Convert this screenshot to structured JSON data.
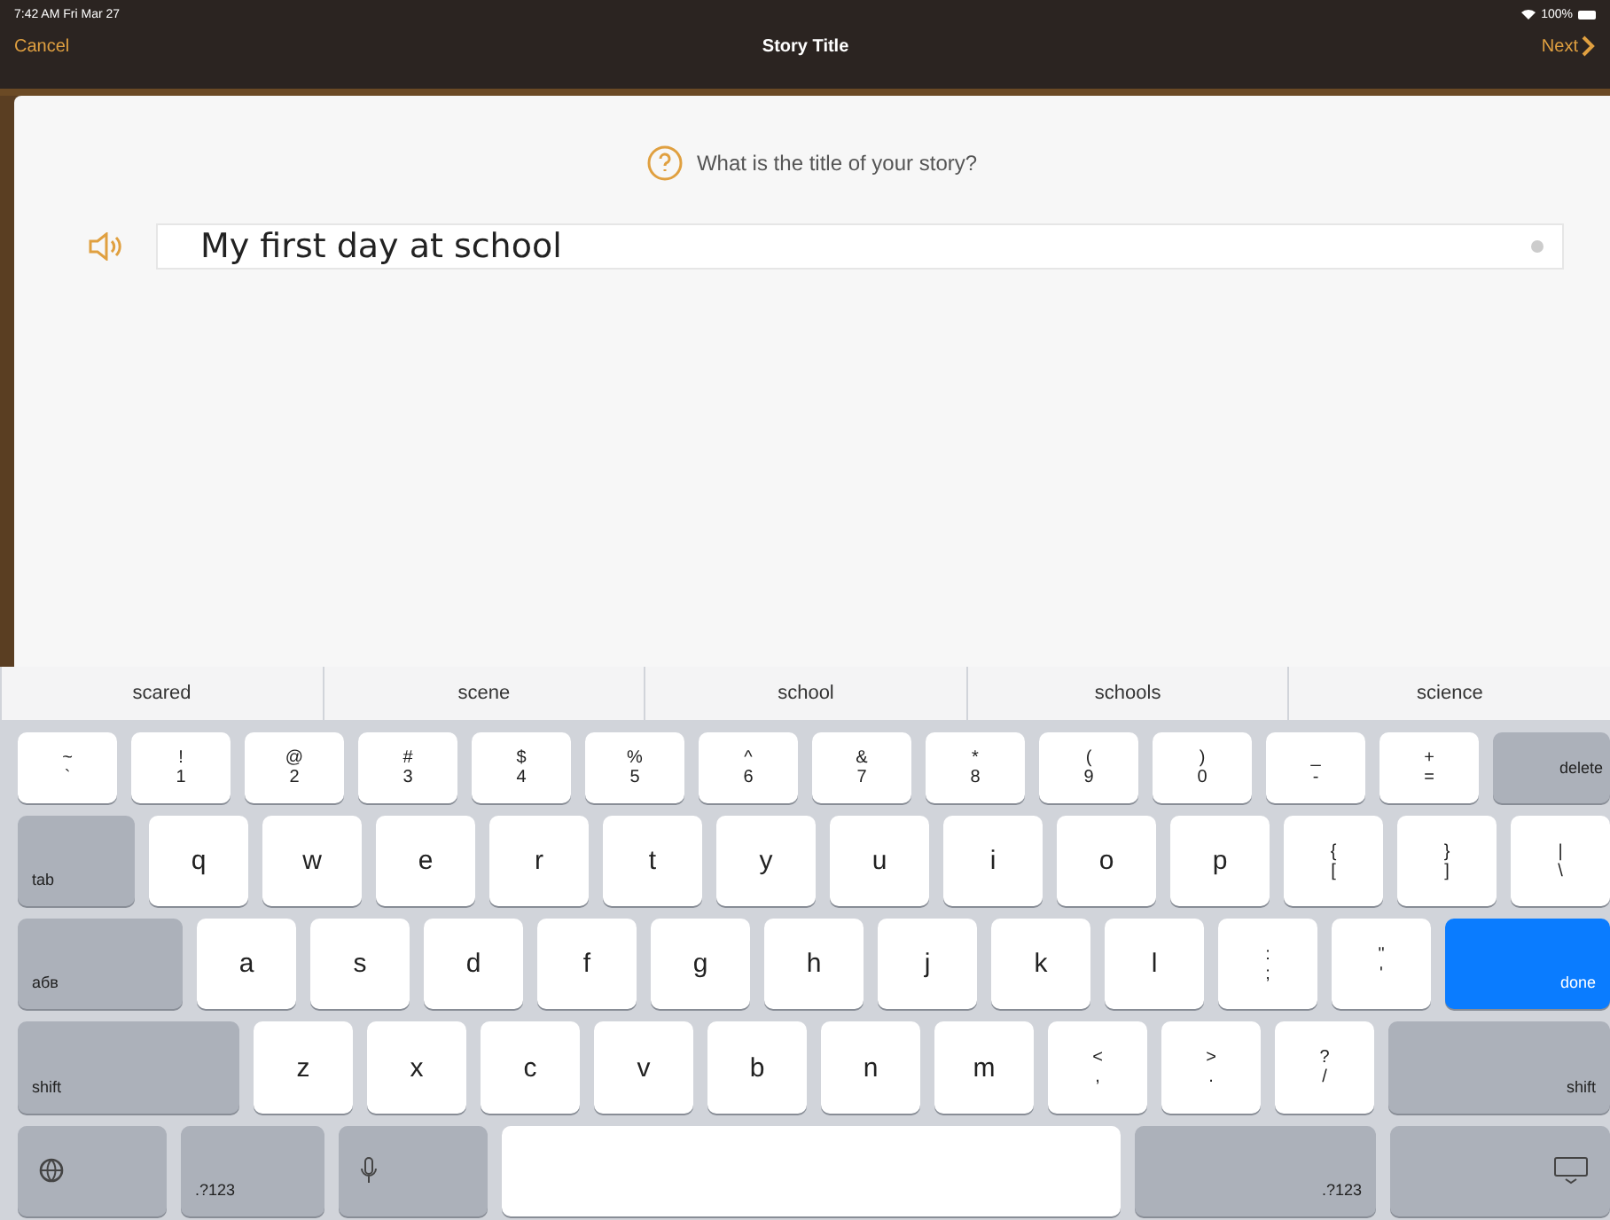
{
  "status_bar": {
    "time": "7:42 AM  Fri Mar 27",
    "battery": "100%"
  },
  "nav_bar": {
    "cancel": "Cancel",
    "title": "Story Title",
    "next": "Next"
  },
  "prompt": "What is the title of your story?",
  "title_field": {
    "value": "My first day at school"
  },
  "keyboard": {
    "suggestions": [
      "scared",
      "scene",
      "school",
      "schools",
      "science"
    ],
    "rows": [
      [
        {
          "kind": "char",
          "top": "~",
          "label": "`"
        },
        {
          "kind": "char",
          "top": "!",
          "label": "1"
        },
        {
          "kind": "char",
          "top": "@",
          "label": "2"
        },
        {
          "kind": "char",
          "top": "#",
          "label": "3"
        },
        {
          "kind": "char",
          "top": "$",
          "label": "4"
        },
        {
          "kind": "char",
          "top": "%",
          "label": "5"
        },
        {
          "kind": "char",
          "top": "^",
          "label": "6"
        },
        {
          "kind": "char",
          "top": "&",
          "label": "7"
        },
        {
          "kind": "char",
          "top": "*",
          "label": "8"
        },
        {
          "kind": "char",
          "top": "(",
          "label": "9"
        },
        {
          "kind": "char",
          "top": ")",
          "label": "0"
        },
        {
          "kind": "char",
          "top": "_",
          "label": "-"
        },
        {
          "kind": "char",
          "top": "+",
          "label": "="
        },
        {
          "kind": "function",
          "label": "delete"
        }
      ],
      [
        {
          "kind": "function",
          "label": "tab"
        },
        {
          "kind": "char",
          "label": "q"
        },
        {
          "kind": "char",
          "label": "w"
        },
        {
          "kind": "char",
          "label": "e"
        },
        {
          "kind": "char",
          "label": "r"
        },
        {
          "kind": "char",
          "label": "t"
        },
        {
          "kind": "char",
          "label": "y"
        },
        {
          "kind": "char",
          "label": "u"
        },
        {
          "kind": "char",
          "label": "i"
        },
        {
          "kind": "char",
          "label": "o"
        },
        {
          "kind": "char",
          "label": "p"
        },
        {
          "kind": "char",
          "top": "{",
          "label": "["
        },
        {
          "kind": "char",
          "top": "}",
          "label": "]"
        },
        {
          "kind": "char",
          "top": "|",
          "label": "\\"
        }
      ],
      [
        {
          "kind": "function",
          "label": "aбв"
        },
        {
          "kind": "char",
          "label": "a"
        },
        {
          "kind": "char",
          "label": "s"
        },
        {
          "kind": "char",
          "label": "d"
        },
        {
          "kind": "char",
          "label": "f"
        },
        {
          "kind": "char",
          "label": "g"
        },
        {
          "kind": "char",
          "label": "h"
        },
        {
          "kind": "char",
          "label": "j"
        },
        {
          "kind": "char",
          "label": "k"
        },
        {
          "kind": "char",
          "label": "l"
        },
        {
          "kind": "char",
          "top": ":",
          "label": ";"
        },
        {
          "kind": "char",
          "top": "\"",
          "label": "'"
        },
        {
          "kind": "done",
          "label": "done"
        }
      ],
      [
        {
          "kind": "function",
          "label": "shift"
        },
        {
          "kind": "char",
          "label": "z"
        },
        {
          "kind": "char",
          "label": "x"
        },
        {
          "kind": "char",
          "label": "c"
        },
        {
          "kind": "char",
          "label": "v"
        },
        {
          "kind": "char",
          "label": "b"
        },
        {
          "kind": "char",
          "label": "n"
        },
        {
          "kind": "char",
          "label": "m"
        },
        {
          "kind": "char",
          "top": "<",
          "label": ","
        },
        {
          "kind": "char",
          "top": ">",
          "label": "."
        },
        {
          "kind": "char",
          "top": "?",
          "label": "/"
        },
        {
          "kind": "function",
          "label": "shift"
        }
      ],
      [
        {
          "kind": "globe"
        },
        {
          "kind": "function",
          "label": ".?123"
        },
        {
          "kind": "mic"
        },
        {
          "kind": "space"
        },
        {
          "kind": "function",
          "label": ".?123"
        },
        {
          "kind": "hide"
        }
      ]
    ]
  }
}
